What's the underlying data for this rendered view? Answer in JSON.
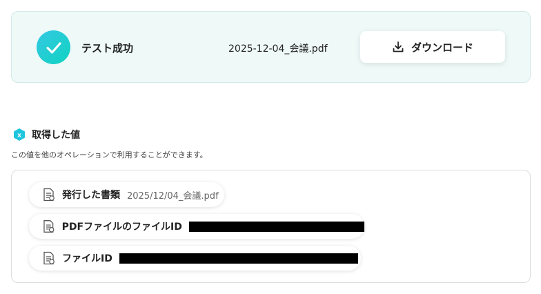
{
  "result": {
    "status_label": "テスト成功",
    "file_name": "2025-12-04_会議.pdf",
    "download_label": "ダウンロード"
  },
  "section": {
    "title": "取得した値",
    "description": "この値を他のオペレーションで利用することができます。"
  },
  "values": [
    {
      "name": "発行した書類",
      "value": "2025/12/04_会議.pdf",
      "redacted": false
    },
    {
      "name": "PDFファイルのファイルID",
      "value": "",
      "redacted": true
    },
    {
      "name": "ファイルID",
      "value": "",
      "redacted": true
    }
  ],
  "colors": {
    "accent_start": "#34c8e3",
    "accent_end": "#10d3c1",
    "card_bg": "#eef9f8"
  }
}
